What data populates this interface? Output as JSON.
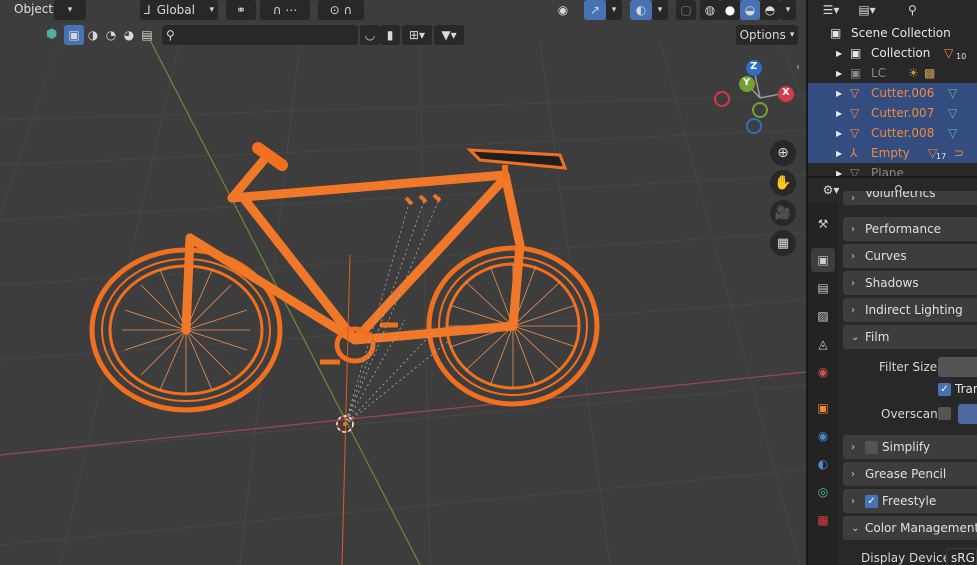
{
  "viewport_header": {
    "mode_label": "Object",
    "transform_orientation": "Global",
    "options_label": "Options",
    "search_placeholder": ""
  },
  "outliner": {
    "rows": [
      {
        "label": "Scene Collection",
        "style": "normal"
      },
      {
        "label": "Collection",
        "style": "normal",
        "count": "10"
      },
      {
        "label": "LC",
        "style": "grey"
      },
      {
        "label": "Cutter.006",
        "style": "orange"
      },
      {
        "label": "Cutter.007",
        "style": "orange"
      },
      {
        "label": "Cutter.008",
        "style": "orange"
      },
      {
        "label": "Empty",
        "style": "orange",
        "count": "17"
      },
      {
        "label": "Plane",
        "style": "grey"
      }
    ]
  },
  "properties": {
    "panels": [
      {
        "label": "Volumetrics",
        "expanded": false
      },
      {
        "label": "Performance",
        "expanded": false
      },
      {
        "label": "Curves",
        "expanded": false
      },
      {
        "label": "Shadows",
        "expanded": false
      },
      {
        "label": "Indirect Lighting",
        "expanded": false
      },
      {
        "label": "Film",
        "expanded": true
      },
      {
        "label": "Simplify",
        "expanded": false,
        "checkbox": false
      },
      {
        "label": "Grease Pencil",
        "expanded": false
      },
      {
        "label": "Freestyle",
        "expanded": false,
        "checkbox": true
      },
      {
        "label": "Color Management",
        "expanded": true
      }
    ],
    "film": {
      "filter_size_label": "Filter Size",
      "transparent_label": "Tran",
      "overscan_label": "Overscan"
    },
    "color_management": {
      "display_device_label": "Display Device",
      "display_device_value": "sRGB"
    }
  },
  "gizmo": {
    "x": "X",
    "y": "Y",
    "z": "Z"
  },
  "colors": {
    "selection": "#f07020",
    "accent": "#4772b3",
    "viewport_bg": "#3d3d3d"
  }
}
